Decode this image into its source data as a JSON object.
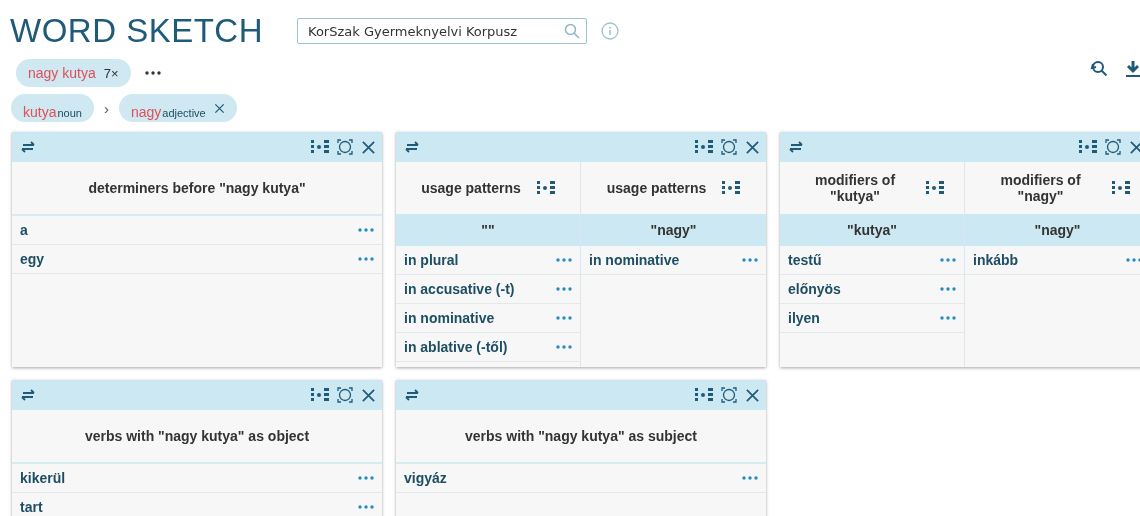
{
  "header": {
    "title": "WORD SKETCH",
    "corpus": {
      "value": "KorSzak Gyermeknyelvi Korpusz"
    }
  },
  "query_chip": {
    "phrase": "nagy kutya",
    "count": "7×"
  },
  "breadcrumb": [
    {
      "word": "kutya",
      "pos": "noun",
      "removable": false
    },
    {
      "word": "nagy",
      "pos": "adjective",
      "removable": true
    }
  ],
  "breadcrumb_separator": "›",
  "cards": [
    {
      "kind": "single",
      "title": "determiners before \"nagy kutya\"",
      "rows": [
        "a",
        "egy"
      ]
    },
    {
      "kind": "dual",
      "columns": [
        {
          "title": "usage patterns",
          "header": "\"\"",
          "rows": [
            "in plural",
            "in accusative (-t)",
            "in nominative",
            "in ablative (-től)"
          ]
        },
        {
          "title": "usage patterns",
          "header": "\"nagy\"",
          "rows": [
            "in nominative"
          ]
        }
      ]
    },
    {
      "kind": "dual",
      "columns": [
        {
          "title": "modifiers of \"kutya\"",
          "header": "\"kutya\"",
          "rows": [
            "testű",
            "előnyös",
            "ilyen"
          ]
        },
        {
          "title": "modifiers of \"nagy\"",
          "header": "\"nagy\"",
          "rows": [
            "inkább"
          ]
        }
      ]
    },
    {
      "kind": "single",
      "title": "verbs with \"nagy kutya\" as object",
      "rows": [
        "kikerül",
        "tart"
      ]
    },
    {
      "kind": "single",
      "title": "verbs with \"nagy kutya\" as subject",
      "rows": [
        "vigyáz"
      ]
    }
  ]
}
